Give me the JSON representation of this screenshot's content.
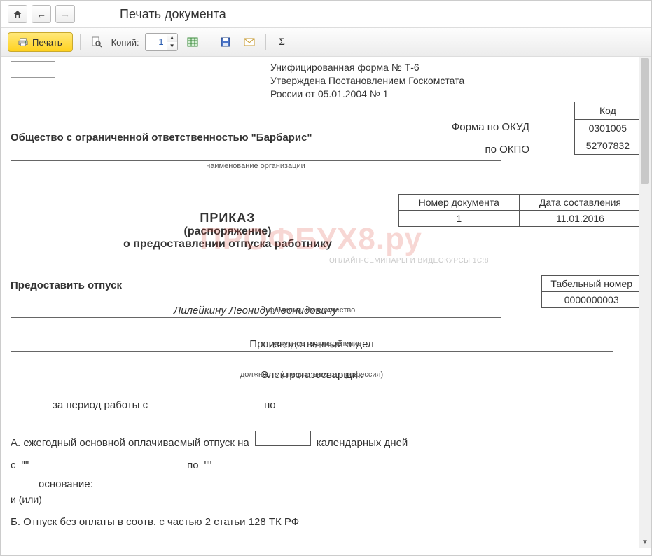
{
  "titlebar": {
    "title": "Печать документа"
  },
  "toolbar": {
    "print_label": "Печать",
    "copies_label": "Копий:",
    "copies_value": "1"
  },
  "doc": {
    "form_info_l1": "Унифицированная форма № Т-6",
    "form_info_l2": "Утверждена Постановлением Госкомстата",
    "form_info_l3": "России от 05.01.2004 № 1",
    "okud_label": "Форма по ОКУД",
    "okpo_label": "по ОКПО",
    "code_header": "Код",
    "okud_code": "0301005",
    "okpo_code": "52707832",
    "org_name": "Общество с ограниченной ответственностью \"Барбарис\"",
    "org_caption": "наименование организации",
    "docnum_header": "Номер документа",
    "docdate_header": "Дата составления",
    "docnum": "1",
    "docdate": "11.01.2016",
    "title_l1": "ПРИКАЗ",
    "title_l2": "(распоряжение)",
    "title_l3": "о предоставлении отпуска работнику",
    "watermark": "ПРОФБУХ8.ру",
    "watermark_sub": "ОНЛАЙН-СЕМИНАРЫ И ВИДЕОКУРСЫ 1С:8",
    "grant_label": "Предоставить отпуск",
    "tabnum_header": "Табельный номер",
    "tabnum": "0000000003",
    "fio": "Лилейкину Леониду Леонидовичу",
    "fio_caption": "фамилия, имя, отчество",
    "dept": "Производственный отдел",
    "dept_caption": "структурное подразделение",
    "job": "Электрогазосварщик",
    "job_caption": "должность (специальность, профессия)",
    "period_label": "за период работы с",
    "period_to": "по",
    "sectA_label": "А. ежегодный основной оплачиваемый отпуск на",
    "sectA_days": "календарных дней",
    "dates_from": "с",
    "dates_quote1": "\"\"",
    "dates_to": "по",
    "dates_quote2": "\"\"",
    "basis_label": "основание:",
    "and_or": "и (или)",
    "sectB_label": "Б.        Отпуск без оплаты в соотв. с частью 2 статьи 128 ТК РФ"
  }
}
